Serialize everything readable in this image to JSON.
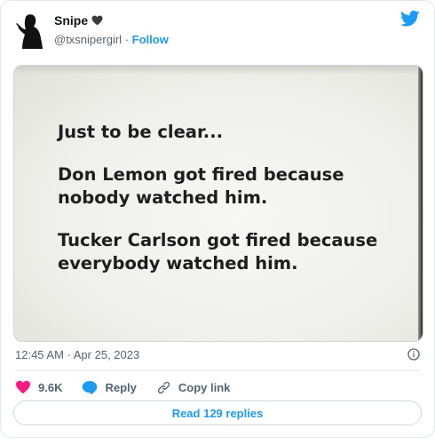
{
  "author": {
    "name": "Snipe",
    "handle": "@txsnipergirl",
    "separator": "·",
    "follow_label": "Follow"
  },
  "icons": {
    "heart_name": "black-heart-icon",
    "brand": "twitter-bird-icon",
    "like": "heart-icon",
    "reply": "speech-bubble-icon",
    "copy": "link-icon",
    "info": "info-icon"
  },
  "media": {
    "lines": [
      "Just to be clear...",
      "Don Lemon got fired because nobody watched him.",
      "Tucker Carlson got fired because everybody watched him."
    ]
  },
  "timestamp": "12:45 AM · Apr 25, 2023",
  "actions": {
    "likes": "9.6K",
    "reply_label": "Reply",
    "copy_label": "Copy link"
  },
  "read_replies_label": "Read 129 replies",
  "colors": {
    "accent": "#1d9bf0",
    "like": "#f91880",
    "muted": "#536471"
  }
}
